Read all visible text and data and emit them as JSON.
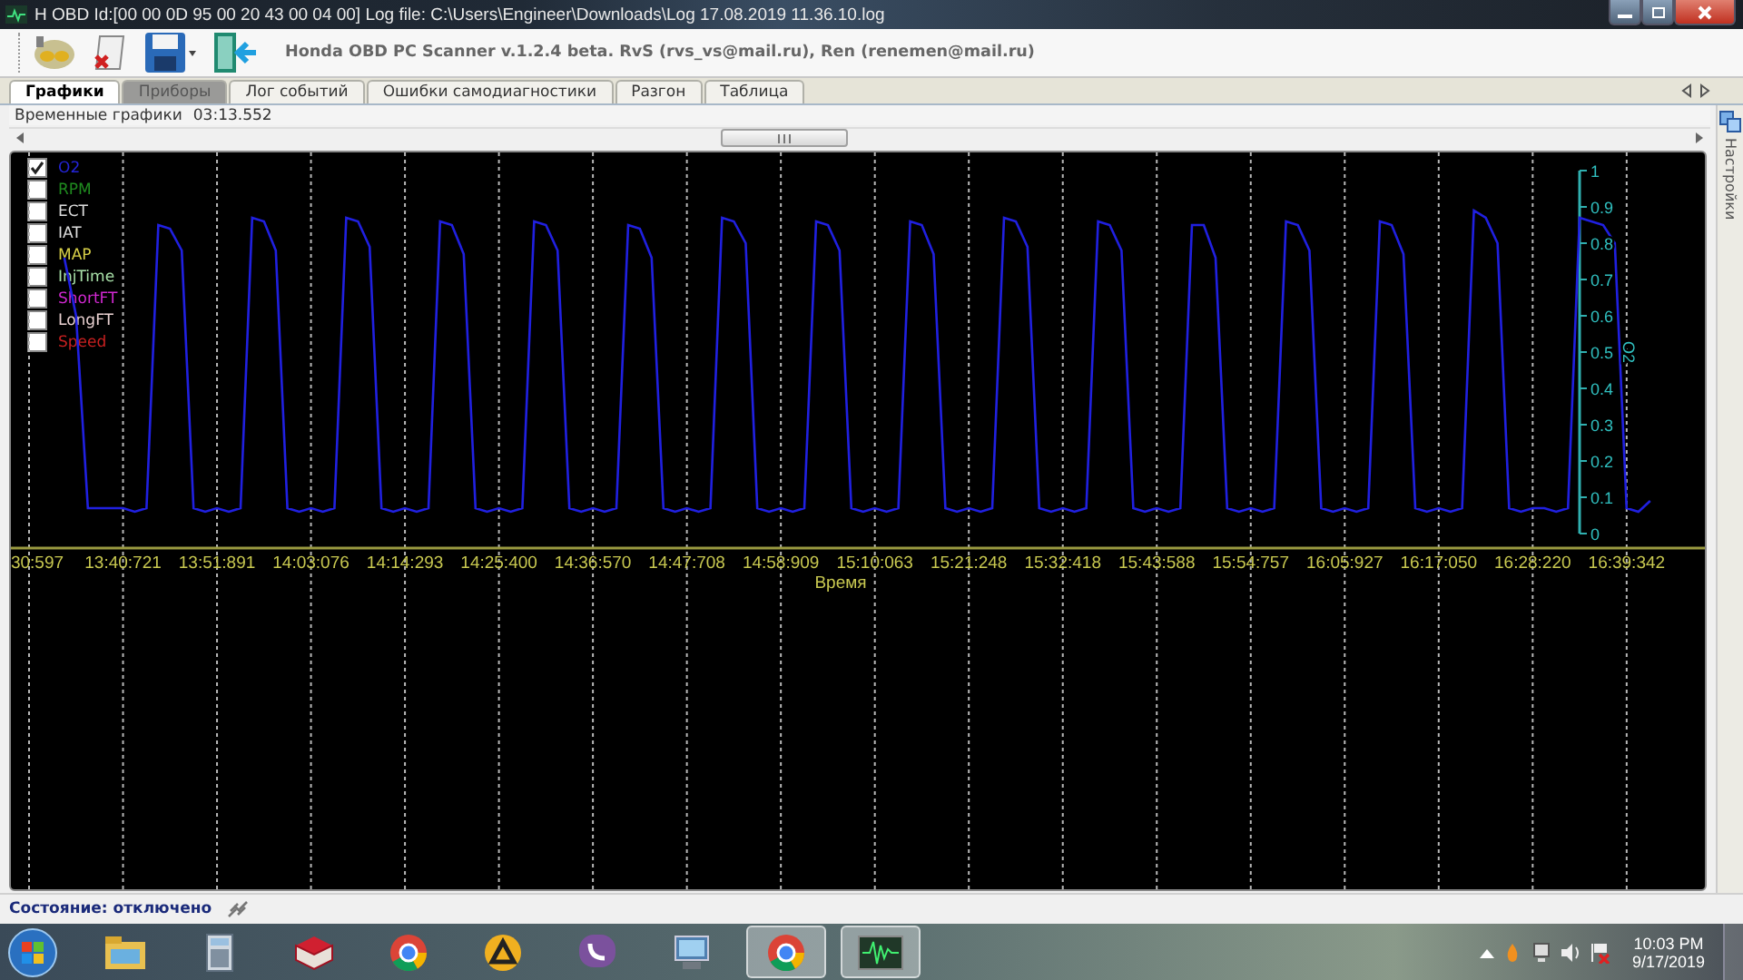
{
  "window": {
    "title": "H OBD Id:[00 00 0D 95 00 20 43 00 04 00] Log file: C:\\Users\\Engineer\\Downloads\\Log 17.08.2019 11.36.10.log"
  },
  "toolbar": {
    "caption": "Honda OBD PC Scanner v.1.2.4 beta. RvS (rvs_vs@mail.ru), Ren (renemen@mail.ru)"
  },
  "tabs": [
    {
      "label": "Графики",
      "selected": true,
      "disabled": false
    },
    {
      "label": "Приборы",
      "selected": false,
      "disabled": true
    },
    {
      "label": "Лог событий",
      "selected": false,
      "disabled": false
    },
    {
      "label": "Ошибки самодиагностики",
      "selected": false,
      "disabled": false
    },
    {
      "label": "Разгон",
      "selected": false,
      "disabled": false
    },
    {
      "label": "Таблица",
      "selected": false,
      "disabled": false
    }
  ],
  "side_panel": {
    "label": "Настройки"
  },
  "panel": {
    "title": "Временные графики",
    "time": "03:13.552"
  },
  "chart": {
    "legend": [
      {
        "name": "O2",
        "color": "#2424d8",
        "checked": true
      },
      {
        "name": "RPM",
        "color": "#1f8a1f",
        "checked": false
      },
      {
        "name": "ECT",
        "color": "#dcdcdc",
        "checked": false
      },
      {
        "name": "IAT",
        "color": "#dcdcdc",
        "checked": false
      },
      {
        "name": "MAP",
        "color": "#d8d048",
        "checked": false
      },
      {
        "name": "InjTime",
        "color": "#a8e0a8",
        "checked": false
      },
      {
        "name": "ShortFT",
        "color": "#d028d0",
        "checked": false
      },
      {
        "name": "LongFT",
        "color": "#e8d0d0",
        "checked": false
      },
      {
        "name": "Speed",
        "color": "#c82020",
        "checked": false
      }
    ],
    "chart_data": {
      "type": "line",
      "xlabel": "Время",
      "ylabel": "O2",
      "ylim": [
        0,
        1
      ],
      "yticks": [
        0,
        0.1,
        0.2,
        0.3,
        0.4,
        0.5,
        0.6,
        0.7,
        0.8,
        0.9,
        1
      ],
      "categories": [
        "30:597",
        null,
        null,
        null,
        null,
        null,
        null,
        null,
        "13:40:721",
        null,
        null,
        null,
        null,
        null,
        null,
        null,
        "13:51:891",
        null,
        null,
        null,
        null,
        null,
        null,
        null,
        "14:03:076",
        null,
        null,
        null,
        null,
        null,
        null,
        null,
        "14:14:293",
        null,
        null,
        null,
        null,
        null,
        null,
        null,
        "14:25:400",
        null,
        null,
        null,
        null,
        null,
        null,
        null,
        "14:36:570",
        null,
        null,
        null,
        null,
        null,
        null,
        null,
        "14:47:708",
        null,
        null,
        null,
        null,
        null,
        null,
        null,
        "14:58:909",
        null,
        null,
        null,
        null,
        null,
        null,
        null,
        "15:10:063",
        null,
        null,
        null,
        null,
        null,
        null,
        null,
        "15:21:248",
        null,
        null,
        null,
        null,
        null,
        null,
        null,
        "15:32:418",
        null,
        null,
        null,
        null,
        null,
        null,
        null,
        "15:43:588",
        null,
        null,
        null,
        null,
        null,
        null,
        null,
        "15:54:757",
        null,
        null,
        null,
        null,
        null,
        null,
        null,
        "16:05:927",
        null,
        null,
        null,
        null,
        null,
        null,
        null,
        "16:17:050",
        null,
        null,
        null,
        null,
        null,
        null,
        null,
        "16:28:220",
        null,
        null,
        null,
        null,
        null,
        null,
        null,
        "16:39:342",
        null,
        null
      ],
      "series": [
        {
          "color": "#2020e0",
          "values": [
            null,
            null,
            null,
            0.76,
            0.6,
            0.07,
            0.07,
            0.07,
            0.07,
            0.06,
            0.07,
            0.85,
            0.84,
            0.78,
            0.07,
            0.06,
            0.07,
            0.06,
            0.07,
            0.87,
            0.86,
            0.78,
            0.07,
            0.06,
            0.07,
            0.06,
            0.07,
            0.87,
            0.86,
            0.79,
            0.07,
            0.06,
            0.07,
            0.06,
            0.07,
            0.86,
            0.85,
            0.77,
            0.07,
            0.06,
            0.07,
            0.06,
            0.07,
            0.86,
            0.85,
            0.78,
            0.07,
            0.06,
            0.07,
            0.06,
            0.07,
            0.85,
            0.84,
            0.76,
            0.07,
            0.06,
            0.07,
            0.06,
            0.07,
            0.87,
            0.86,
            0.8,
            0.07,
            0.06,
            0.07,
            0.06,
            0.07,
            0.86,
            0.85,
            0.78,
            0.07,
            0.06,
            0.07,
            0.06,
            0.07,
            0.86,
            0.85,
            0.77,
            0.07,
            0.06,
            0.07,
            0.06,
            0.07,
            0.87,
            0.86,
            0.79,
            0.07,
            0.06,
            0.07,
            0.06,
            0.07,
            0.86,
            0.85,
            0.78,
            0.07,
            0.06,
            0.07,
            0.06,
            0.07,
            0.85,
            0.85,
            0.76,
            0.07,
            0.06,
            0.07,
            0.06,
            0.07,
            0.86,
            0.85,
            0.78,
            0.07,
            0.06,
            0.07,
            0.06,
            0.07,
            0.86,
            0.85,
            0.77,
            0.07,
            0.06,
            0.07,
            0.06,
            0.07,
            0.89,
            0.87,
            0.8,
            0.07,
            0.06,
            0.07,
            0.07,
            0.06,
            0.07,
            0.87,
            0.86,
            0.85,
            0.8,
            0.07,
            0.06,
            0.09
          ]
        }
      ]
    }
  },
  "status_bar": {
    "text": "Состояние: отключено"
  },
  "taskbar": {
    "apps": [
      {
        "active": false
      },
      {
        "active": false
      },
      {
        "active": false
      },
      {
        "active": false
      },
      {
        "active": false
      },
      {
        "active": false
      },
      {
        "active": false
      },
      {
        "active": true
      },
      {
        "active": true
      }
    ],
    "time": "10:03 PM",
    "date": "9/17/2019"
  }
}
